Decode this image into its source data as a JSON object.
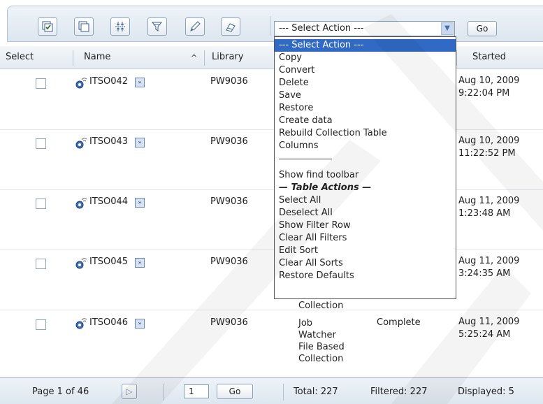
{
  "toolbar": {
    "icons": [
      "select-all-icon",
      "copy-icon",
      "filter-icon",
      "find-icon",
      "edit-icon",
      "clear-icon"
    ],
    "select_action_value": "--- Select Action ---",
    "go_label": "Go"
  },
  "columns": [
    "Select",
    "Name",
    "Library",
    "Started"
  ],
  "rows": [
    {
      "name": "ITSO042",
      "library": "PW9036",
      "description": [
        "",
        "",
        "",
        ""
      ],
      "status": "",
      "started": [
        "Aug 10, 2009",
        "9:22:04 PM"
      ]
    },
    {
      "name": "ITSO043",
      "library": "PW9036",
      "description": [
        "",
        "",
        "",
        ""
      ],
      "status": "",
      "started": [
        "Aug 10, 2009",
        "11:22:52 PM"
      ]
    },
    {
      "name": "ITSO044",
      "library": "PW9036",
      "description": [
        "",
        "",
        "",
        ""
      ],
      "status": "",
      "started": [
        "Aug 11, 2009",
        "1:23:48 AM"
      ]
    },
    {
      "name": "ITSO045",
      "library": "PW9036",
      "description": [
        "",
        "",
        "",
        "Collection"
      ],
      "status": "",
      "started": [
        "Aug 11, 2009",
        "3:24:35 AM"
      ]
    },
    {
      "name": "ITSO046",
      "library": "PW9036",
      "description": [
        "Job",
        "Watcher",
        "File Based",
        "Collection"
      ],
      "status": "Complete",
      "started": [
        "Aug 11, 2009",
        "5:25:24 AM"
      ]
    }
  ],
  "dropdown": {
    "items": [
      "--- Select Action ---",
      "Copy",
      "Convert",
      "Delete",
      "Save",
      "Restore",
      "Create data",
      "Rebuild Collection Table",
      "Columns",
      "",
      "Show find toolbar",
      "— Table Actions —",
      "Select All",
      "Deselect All",
      "Show Filter Row",
      "Clear All Filters",
      "Edit Sort",
      "Clear All Sorts",
      "Restore Defaults"
    ]
  },
  "footer": {
    "page_label": "Page 1 of 46",
    "page_input": "1",
    "go_label": "Go",
    "total": "Total: 227",
    "filtered": "Filtered: 227",
    "displayed": "Displayed: 5"
  },
  "colors": {
    "selected_item": "#316ac5",
    "toolbar_bg": "#e6ecf3"
  }
}
